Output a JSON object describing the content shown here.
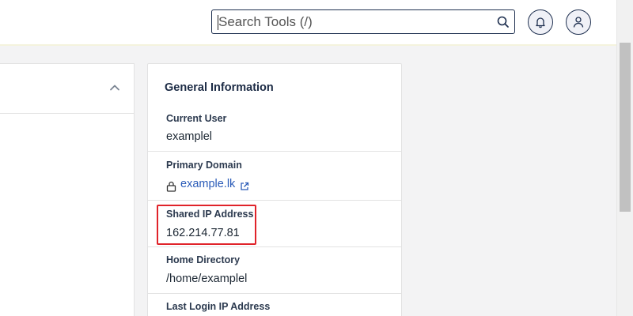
{
  "header": {
    "search": {
      "placeholder": "Search Tools (/)",
      "value": ""
    },
    "icons": {
      "search": "search-icon",
      "notifications": "bell-icon",
      "user": "user-icon"
    }
  },
  "left_panel": {
    "toggle_icon": "chevron-up-icon"
  },
  "general_info": {
    "title": "General Information",
    "rows": [
      {
        "label": "Current User",
        "value": "examplel"
      },
      {
        "label": "Primary Domain",
        "value": "example.lk"
      },
      {
        "label": "Shared IP Address",
        "value": "162.214.77.81"
      },
      {
        "label": "Home Directory",
        "value": "/home/examplel"
      },
      {
        "label": "Last Login IP Address",
        "value": ""
      }
    ]
  },
  "colors": {
    "highlight": "#e0232a",
    "link": "#2a5bb8",
    "header_border": "#1f3050"
  }
}
